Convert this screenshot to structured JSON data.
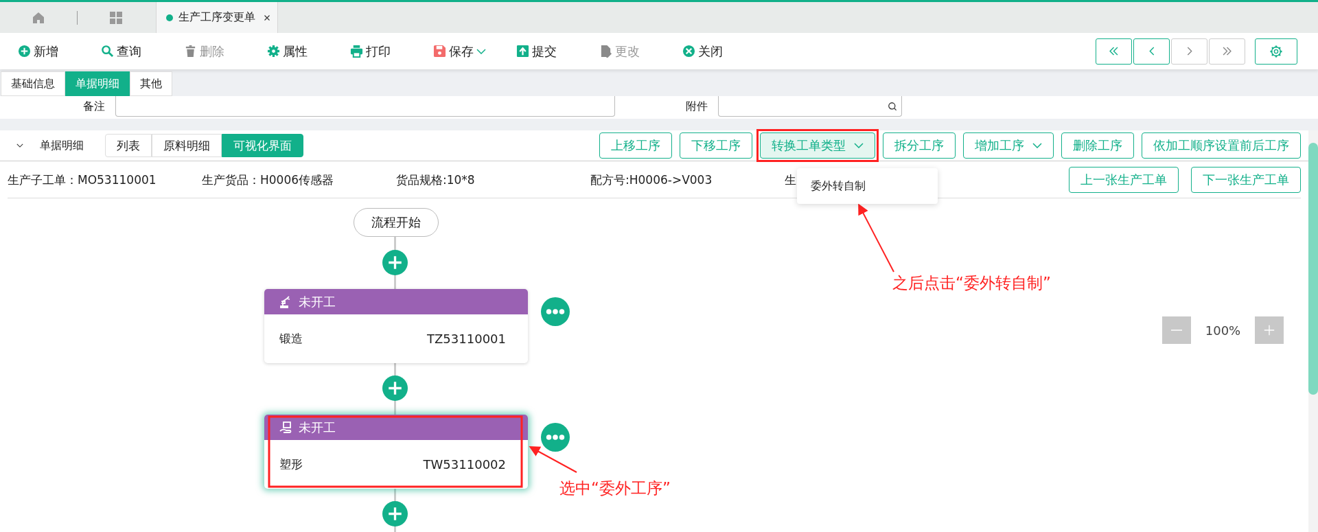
{
  "doc_tabs": [
    {
      "label": "生产工序变更单",
      "selected": true
    }
  ],
  "toolbar": [
    {
      "kind": "add",
      "label": "新增",
      "disabled": false
    },
    {
      "kind": "query",
      "label": "查询",
      "disabled": false
    },
    {
      "kind": "delete",
      "label": "删除",
      "disabled": true
    },
    {
      "kind": "property",
      "label": "属性",
      "disabled": false
    },
    {
      "kind": "print",
      "label": "打印",
      "disabled": false
    },
    {
      "kind": "save",
      "label": "保存",
      "disabled": false,
      "dropdown": true
    },
    {
      "kind": "submit",
      "label": "提交",
      "disabled": false
    },
    {
      "kind": "edit",
      "label": "更改",
      "disabled": true
    },
    {
      "kind": "close",
      "label": "关闭",
      "disabled": false
    }
  ],
  "pager": [
    {
      "kind": "first",
      "disabled": false
    },
    {
      "kind": "prev",
      "disabled": false
    },
    {
      "kind": "next",
      "disabled": true
    },
    {
      "kind": "last",
      "disabled": true
    }
  ],
  "form_tabs": [
    {
      "label": "基础信息",
      "selected": false
    },
    {
      "label": "单据明细",
      "selected": true
    },
    {
      "label": "其他",
      "selected": false
    }
  ],
  "form_fields": [
    {
      "label": "备注",
      "kind": "text"
    },
    {
      "label": "附件",
      "kind": "search"
    }
  ],
  "section": {
    "title": "单据明细",
    "expanded": true,
    "view_tabs": [
      {
        "label": "列表",
        "selected": false
      },
      {
        "label": "原料明细",
        "selected": false
      },
      {
        "label": "可视化界面",
        "selected": true
      }
    ],
    "actions": [
      {
        "label": "上移工序",
        "dropdown": false,
        "open": false
      },
      {
        "label": "下移工序",
        "dropdown": false,
        "open": false
      },
      {
        "label": "转换工单类型",
        "dropdown": true,
        "open": true
      },
      {
        "label": "拆分工序",
        "dropdown": false,
        "open": false
      },
      {
        "label": "增加工序",
        "dropdown": true,
        "open": false
      },
      {
        "label": "删除工序",
        "dropdown": false,
        "open": false
      },
      {
        "label": "依加工顺序设置前后工序",
        "dropdown": false,
        "open": false
      }
    ],
    "menu_items": [
      "委外转自制"
    ]
  },
  "info": [
    "生产子工单：MO53110001",
    "生产货品：H0006传感器",
    "货品规格:10*8",
    "配方号:H0006->V003",
    "生"
  ],
  "order_nav": [
    "上一张生产工单",
    "下一张生产工单"
  ],
  "flow": {
    "start": "流程开始",
    "steps": [
      {
        "kind": "robot",
        "status": "未开工",
        "name": "锻造",
        "code": "TZ53110001",
        "selected": false
      },
      {
        "kind": "outsource",
        "status": "未开工",
        "name": "塑形",
        "code": "TW53110002",
        "selected": true
      }
    ]
  },
  "zoom": "100%",
  "annotations": [
    "之后点击“委外转自制”",
    "选中“委外工序”"
  ]
}
